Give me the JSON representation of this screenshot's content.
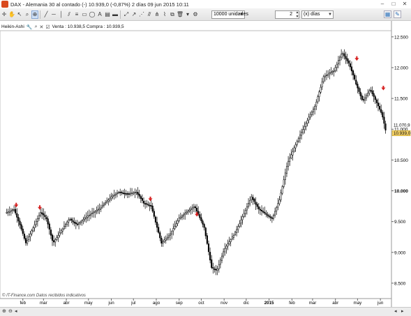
{
  "window": {
    "title": "DAX - Alemania 30 al contado (-)   10.939,0 (-0,87%)   2 días  09 jun 2015 10:11",
    "controls": {
      "minimize": "–",
      "maximize": "□",
      "close": "✕"
    }
  },
  "toolbar": {
    "units_select": "10000 unidades",
    "period_value": "2",
    "period_unit": "(x) días"
  },
  "chart_header": {
    "indicator_name": "Heikin-Ashi",
    "quote": "Venta : 10.938,5 Compra : 10.939,5"
  },
  "footer": {
    "note": "© IT-Finance.com  Datos recibidos indicativos"
  },
  "chart_data": {
    "type": "candlestick",
    "subtype": "Heikin-Ashi",
    "colors": {
      "up": "#ffffff",
      "down": "#000000",
      "wick": "#000000",
      "signal": "#d62020"
    },
    "ylim": [
      8250,
      12600
    ],
    "y_ticks": [
      {
        "value": 12500,
        "label": "12.500",
        "bold": false
      },
      {
        "value": 12000,
        "label": "12.000",
        "bold": false
      },
      {
        "value": 11500,
        "label": "11.500",
        "bold": false
      },
      {
        "value": 11000,
        "label": "11.000",
        "bold": false
      },
      {
        "value": 10500,
        "label": "10.500",
        "bold": false
      },
      {
        "value": 10000,
        "label": "10.000",
        "bold": true
      },
      {
        "value": 9500,
        "label": "9.500",
        "bold": false
      },
      {
        "value": 9000,
        "label": "9.000",
        "bold": false
      },
      {
        "value": 8500,
        "label": "8.500",
        "bold": false
      }
    ],
    "price_labels": [
      {
        "value": 11070.9,
        "label": "11.070,9",
        "highlight": false
      },
      {
        "value": 10939.0,
        "label": "10.939,0",
        "highlight": true
      }
    ],
    "x_ticks": [
      {
        "date": "2014-02",
        "label": "feb",
        "bold": false
      },
      {
        "date": "2014-03",
        "label": "mar",
        "bold": false
      },
      {
        "date": "2014-04",
        "label": "abr",
        "bold": false
      },
      {
        "date": "2014-05",
        "label": "may",
        "bold": false
      },
      {
        "date": "2014-06",
        "label": "jun",
        "bold": false
      },
      {
        "date": "2014-07",
        "label": "jul",
        "bold": false
      },
      {
        "date": "2014-08",
        "label": "ago",
        "bold": false
      },
      {
        "date": "2014-09",
        "label": "sep",
        "bold": false
      },
      {
        "date": "2014-10",
        "label": "oct",
        "bold": false
      },
      {
        "date": "2014-11",
        "label": "nov",
        "bold": false
      },
      {
        "date": "2014-12",
        "label": "dic",
        "bold": false
      },
      {
        "date": "2015-01",
        "label": "2015",
        "bold": true
      },
      {
        "date": "2015-02",
        "label": "feb",
        "bold": false
      },
      {
        "date": "2015-03",
        "label": "mar",
        "bold": false
      },
      {
        "date": "2015-04",
        "label": "abr",
        "bold": false
      },
      {
        "date": "2015-05",
        "label": "may",
        "bold": false
      },
      {
        "date": "2015-06",
        "label": "jun",
        "bold": false
      }
    ],
    "path_points": [
      [
        "2014-01-10",
        9650
      ],
      [
        "2014-01-20",
        9700
      ],
      [
        "2014-01-28",
        9450
      ],
      [
        "2014-02-05",
        9150
      ],
      [
        "2014-02-15",
        9400
      ],
      [
        "2014-02-25",
        9650
      ],
      [
        "2014-03-05",
        9550
      ],
      [
        "2014-03-14",
        9150
      ],
      [
        "2014-03-25",
        9350
      ],
      [
        "2014-04-05",
        9550
      ],
      [
        "2014-04-15",
        9450
      ],
      [
        "2014-05-01",
        9600
      ],
      [
        "2014-05-15",
        9700
      ],
      [
        "2014-06-01",
        9900
      ],
      [
        "2014-06-10",
        9980
      ],
      [
        "2014-06-25",
        9950
      ],
      [
        "2014-07-05",
        9980
      ],
      [
        "2014-07-15",
        9800
      ],
      [
        "2014-07-25",
        9750
      ],
      [
        "2014-08-08",
        9150
      ],
      [
        "2014-08-20",
        9300
      ],
      [
        "2014-09-01",
        9550
      ],
      [
        "2014-09-10",
        9650
      ],
      [
        "2014-09-22",
        9750
      ],
      [
        "2014-10-05",
        9400
      ],
      [
        "2014-10-15",
        8750
      ],
      [
        "2014-10-22",
        8700
      ],
      [
        "2014-11-01",
        9050
      ],
      [
        "2014-11-15",
        9300
      ],
      [
        "2014-11-25",
        9550
      ],
      [
        "2014-12-08",
        9900
      ],
      [
        "2014-12-18",
        9700
      ],
      [
        "2015-01-05",
        9550
      ],
      [
        "2015-01-15",
        9850
      ],
      [
        "2015-01-26",
        10450
      ],
      [
        "2015-02-08",
        10800
      ],
      [
        "2015-02-20",
        11100
      ],
      [
        "2015-03-05",
        11400
      ],
      [
        "2015-03-16",
        11850
      ],
      [
        "2015-03-30",
        11950
      ],
      [
        "2015-04-10",
        12250
      ],
      [
        "2015-04-20",
        12050
      ],
      [
        "2015-04-30",
        11700
      ],
      [
        "2015-05-08",
        11450
      ],
      [
        "2015-05-18",
        11650
      ],
      [
        "2015-05-28",
        11400
      ],
      [
        "2015-06-03",
        11250
      ],
      [
        "2015-06-09",
        10939
      ]
    ],
    "signals": [
      {
        "date": "2014-01-23",
        "value": 9760
      },
      {
        "date": "2014-02-24",
        "value": 9720
      },
      {
        "date": "2014-07-24",
        "value": 9860
      },
      {
        "date": "2014-09-25",
        "value": 9610
      },
      {
        "date": "2015-04-30",
        "value": 12140
      },
      {
        "date": "2015-06-05",
        "value": 11660
      }
    ]
  }
}
